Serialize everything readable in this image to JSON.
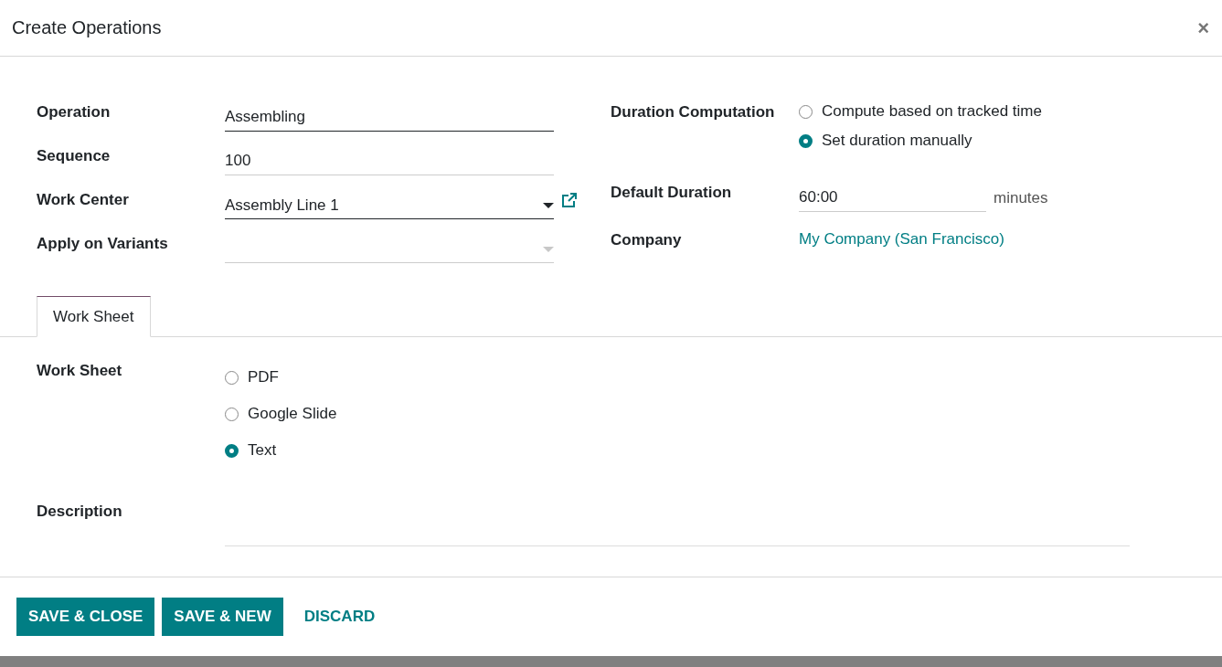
{
  "dialog": {
    "title": "Create Operations",
    "close": "×"
  },
  "left_fields": [
    {
      "label": "Operation",
      "kind": "text",
      "value": "Assembling",
      "required": true
    },
    {
      "label": "Sequence",
      "kind": "text",
      "value": "100",
      "required": false
    },
    {
      "label": "Work Center",
      "kind": "select",
      "value": "Assembly Line 1",
      "required": true,
      "link": true
    },
    {
      "label": "Apply on Variants",
      "kind": "select",
      "required": false,
      "link": false
    }
  ],
  "right_fields": [
    {
      "label": "Duration Computation",
      "kind": "radio",
      "options": [
        {
          "label": "Compute based on tracked time",
          "selected": false
        },
        {
          "label": "Set duration manually",
          "selected": true
        }
      ]
    },
    {
      "label": "Default Duration",
      "kind": "text",
      "value": "60:00",
      "suffix": "minutes",
      "required": false
    },
    {
      "label": "Company",
      "kind": "link",
      "value": "My Company (San Francisco)"
    }
  ],
  "tabs": [
    {
      "label": "Work Sheet",
      "selected": true
    }
  ],
  "tab_fields": [
    {
      "label": "Work Sheet",
      "kind": "radio",
      "options": [
        {
          "label": "PDF",
          "selected": false
        },
        {
          "label": "Google Slide",
          "selected": false
        },
        {
          "label": "Text",
          "selected": true
        }
      ]
    },
    {
      "label": "Description",
      "kind": "textarea"
    }
  ],
  "buttons": [
    {
      "label": "SAVE & CLOSE",
      "kind": "primary"
    },
    {
      "label": "SAVE & NEW",
      "kind": "primary"
    },
    {
      "label": "DISCARD",
      "kind": "link"
    }
  ]
}
